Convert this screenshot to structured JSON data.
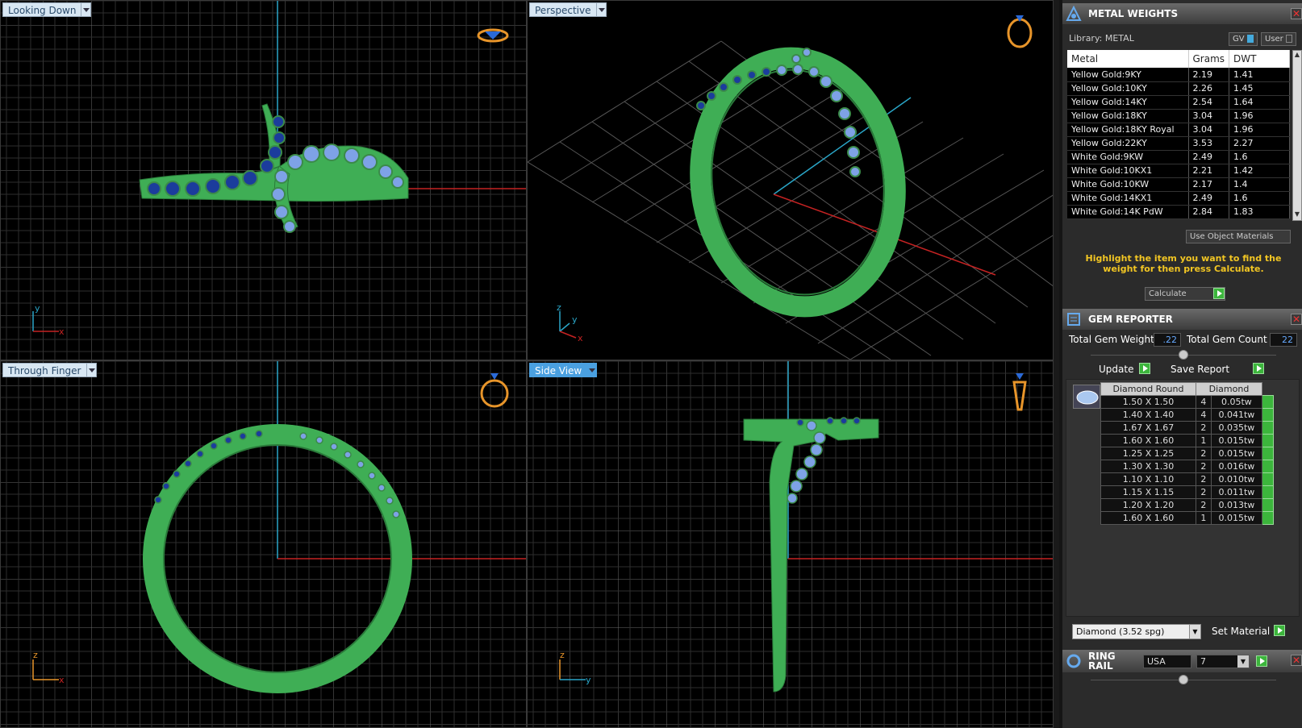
{
  "viewports": {
    "top_left": {
      "label": "Looking Down"
    },
    "top_right": {
      "label": "Perspective"
    },
    "bottom_left": {
      "label": "Through Finger"
    },
    "bottom_right": {
      "label": "Side View"
    }
  },
  "axes": {
    "x": "x",
    "y": "y",
    "z": "z"
  },
  "metal_weights": {
    "title": "METAL WEIGHTS",
    "library_label": "Library: METAL",
    "gv_label": "GV",
    "user_label": "User",
    "columns": [
      "Metal",
      "Grams",
      "DWT"
    ],
    "rows": [
      [
        "Yellow Gold:9KY",
        "2.19",
        "1.41"
      ],
      [
        "Yellow Gold:10KY",
        "2.26",
        "1.45"
      ],
      [
        "Yellow Gold:14KY",
        "2.54",
        "1.64"
      ],
      [
        "Yellow Gold:18KY",
        "3.04",
        "1.96"
      ],
      [
        "Yellow Gold:18KY Royal",
        "3.04",
        "1.96"
      ],
      [
        "Yellow Gold:22KY",
        "3.53",
        "2.27"
      ],
      [
        "White Gold:9KW",
        "2.49",
        "1.6"
      ],
      [
        "White Gold:10KX1",
        "2.21",
        "1.42"
      ],
      [
        "White Gold:10KW",
        "2.17",
        "1.4"
      ],
      [
        "White Gold:14KX1",
        "2.49",
        "1.6"
      ],
      [
        "White Gold:14K PdW",
        "2.84",
        "1.83"
      ]
    ],
    "use_object_materials": "Use Object Materials",
    "hint": "Highlight the item you want to find the weight for then press Calculate.",
    "calculate": "Calculate"
  },
  "gem_reporter": {
    "title": "GEM REPORTER",
    "total_weight_label": "Total Gem Weight",
    "total_weight": ".22",
    "total_count_label": "Total Gem Count",
    "total_count": "22",
    "update": "Update",
    "save_report": "Save Report",
    "columns": [
      "Diamond Round",
      "Diamond"
    ],
    "rows": [
      [
        "1.50 X 1.50",
        "4",
        "0.05tw"
      ],
      [
        "1.40 X 1.40",
        "4",
        "0.041tw"
      ],
      [
        "1.67 X 1.67",
        "2",
        "0.035tw"
      ],
      [
        "1.60 X 1.60",
        "1",
        "0.015tw"
      ],
      [
        "1.25 X 1.25",
        "2",
        "0.015tw"
      ],
      [
        "1.30 X 1.30",
        "2",
        "0.016tw"
      ],
      [
        "1.10 X 1.10",
        "2",
        "0.010tw"
      ],
      [
        "1.15 X 1.15",
        "2",
        "0.011tw"
      ],
      [
        "1.20 X 1.20",
        "2",
        "0.013tw"
      ],
      [
        "1.60 X 1.60",
        "1",
        "0.015tw"
      ]
    ],
    "material_select": "Diamond    (3.52 spg)",
    "set_material": "Set Material"
  },
  "ring_rail": {
    "title": "RING RAIL",
    "country": "USA",
    "size": "7"
  },
  "colors": {
    "ring_green": "#3fae55",
    "gem_dark": "#1b3c9c",
    "gem_light": "#7ea2e6",
    "hint_yellow": "#f2c623"
  }
}
